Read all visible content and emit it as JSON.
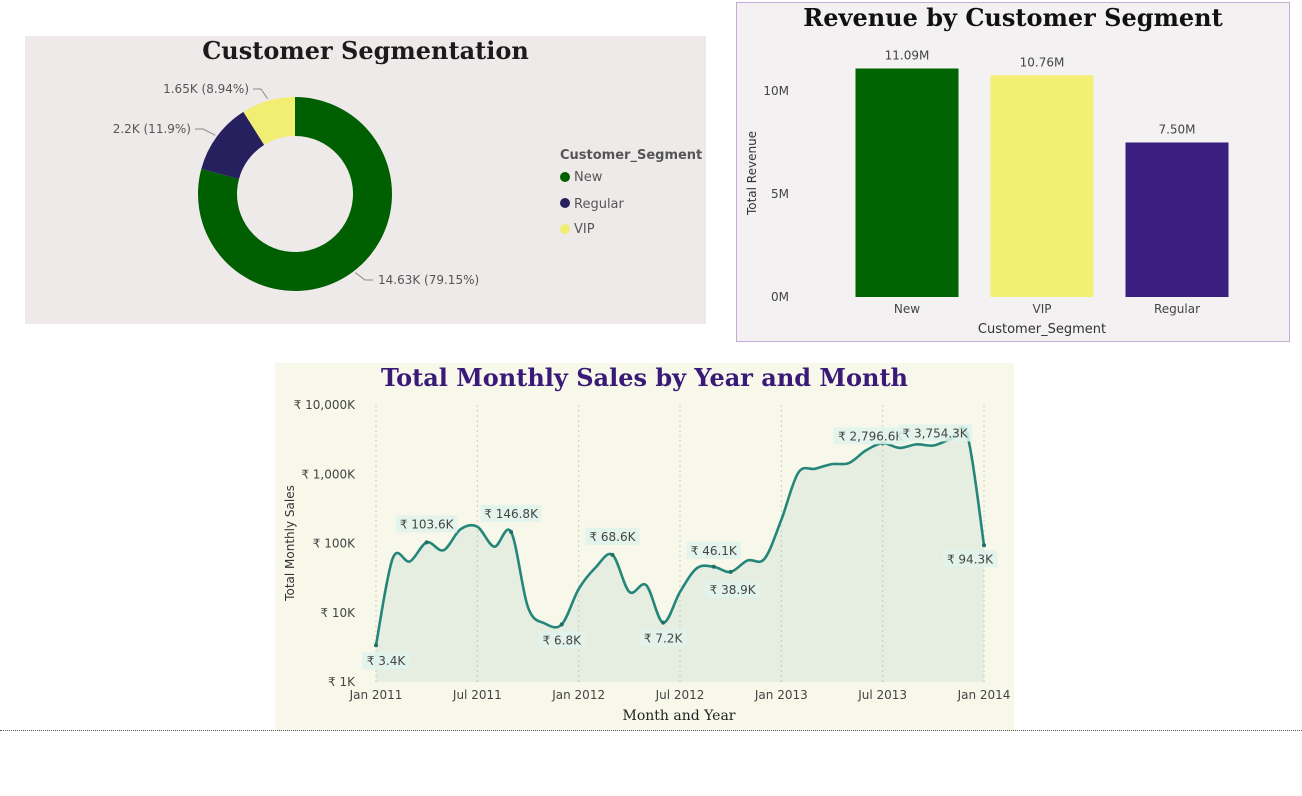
{
  "charts": {
    "donut": {
      "title": "Customer Segmentation",
      "legend_title": "Customer_Segment",
      "legend": [
        {
          "label": "New",
          "color": "#005f00"
        },
        {
          "label": "Regular",
          "color": "#27205e"
        },
        {
          "label": "VIP",
          "color": "#f2ee73"
        }
      ],
      "slice_labels": [
        "14.63K (79.15%)",
        "2.2K (11.9%)",
        "1.65K (8.94%)"
      ]
    },
    "bar": {
      "title": "Revenue by Customer Segment",
      "xlabel": "Customer_Segment",
      "ylabel": "Total Revenue",
      "y_ticks": [
        "0M",
        "5M",
        "10M"
      ],
      "value_labels": [
        "11.09M",
        "10.76M",
        "7.50M"
      ]
    },
    "line": {
      "title": "Total Monthly Sales by Year and Month",
      "xlabel": "Month and Year",
      "ylabel": "Total Monthly Sales",
      "y_ticks": [
        "₹ 1K",
        "₹ 10K",
        "₹ 100K",
        "₹ 1,000K",
        "₹ 10,000K"
      ],
      "x_ticks": [
        "Jan 2011",
        "Jul 2011",
        "Jan 2012",
        "Jul 2012",
        "Jan 2013",
        "Jul 2013",
        "Jan 2014"
      ],
      "point_labels": [
        "₹ 3.4K",
        "₹ 103.6K",
        "₹ 146.8K",
        "₹ 6.8K",
        "₹ 68.6K",
        "₹ 7.2K",
        "₹ 46.1K",
        "₹ 38.9K",
        "₹ 2,796.6K",
        "₹ 3,754.3K",
        "₹ 94.3K"
      ]
    }
  },
  "chart_data": [
    {
      "type": "pie",
      "title": "Customer Segmentation",
      "legend_title": "Customer_Segment",
      "legend_position": "right",
      "categories": [
        "New",
        "Regular",
        "VIP"
      ],
      "values": [
        14630,
        2200,
        1650
      ],
      "percentages": [
        79.15,
        11.9,
        8.94
      ],
      "colors": [
        "#005f00",
        "#27205e",
        "#f2ee73"
      ]
    },
    {
      "type": "bar",
      "title": "Revenue by Customer Segment",
      "xlabel": "Customer_Segment",
      "ylabel": "Total Revenue",
      "categories": [
        "New",
        "VIP",
        "Regular"
      ],
      "values": [
        11.09,
        10.76,
        7.5
      ],
      "unit": "M",
      "ylim": [
        0,
        11.6
      ],
      "colors": [
        "#006400",
        "#f3ef73",
        "#3a1f80"
      ],
      "grid": false
    },
    {
      "type": "line",
      "title": "Total Monthly Sales by Year and Month",
      "xlabel": "Month and Year",
      "ylabel": "Total Monthly Sales",
      "y_scale": "log",
      "ylim": [
        1,
        10000
      ],
      "y_unit": "₹ K",
      "x": [
        "Jan 2011",
        "Feb 2011",
        "Mar 2011",
        "Apr 2011",
        "May 2011",
        "Jun 2011",
        "Jul 2011",
        "Aug 2011",
        "Sep 2011",
        "Oct 2011",
        "Nov 2011",
        "Dec 2011",
        "Jan 2012",
        "Feb 2012",
        "Mar 2012",
        "Apr 2012",
        "May 2012",
        "Jun 2012",
        "Jul 2012",
        "Aug 2012",
        "Sep 2012",
        "Oct 2012",
        "Nov 2012",
        "Dec 2012",
        "Jan 2013",
        "Feb 2013",
        "Mar 2013",
        "Apr 2013",
        "May 2013",
        "Jun 2013",
        "Jul 2013",
        "Aug 2013",
        "Sep 2013",
        "Oct 2013",
        "Nov 2013",
        "Dec 2013",
        "Jan 2014"
      ],
      "values": [
        3.4,
        62,
        55,
        103.6,
        80,
        160,
        175,
        90,
        146.8,
        12,
        7,
        6.8,
        22,
        45,
        68.6,
        20,
        25,
        7.2,
        20,
        44,
        46.1,
        38.9,
        57,
        60,
        220,
        1050,
        1200,
        1400,
        1450,
        2200,
        2796.6,
        2400,
        2700,
        2600,
        3200,
        3754.3,
        94.3
      ],
      "labeled_points": {
        "Jan 2011": 3.4,
        "Apr 2011": 103.6,
        "Sep 2011": 146.8,
        "Dec 2011": 6.8,
        "Mar 2012": 68.6,
        "Jun 2012": 7.2,
        "Sep 2012": 46.1,
        "Oct 2012": 38.9,
        "Jul 2013": 2796.6,
        "Dec 2013": 3754.3,
        "Jan 2014": 94.3
      },
      "color": "#24867a",
      "grid": true
    }
  ]
}
